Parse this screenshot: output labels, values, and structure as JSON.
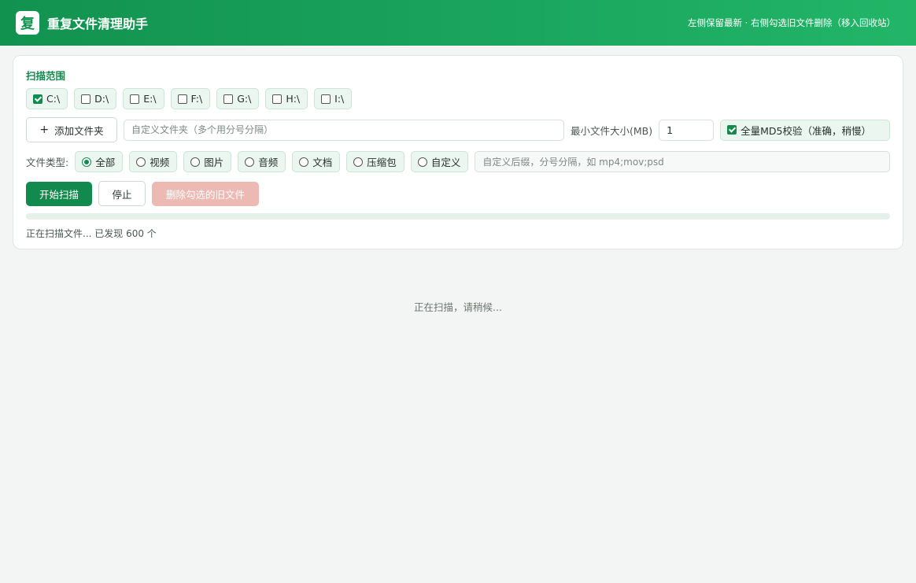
{
  "header": {
    "logo_char": "复",
    "title": "重复文件清理助手",
    "tip": "左侧保留最新 · 右侧勾选旧文件删除（移入回收站）",
    "accent": "#138a4d"
  },
  "scan": {
    "section_title": "扫描范围",
    "drives": [
      {
        "label": "C:\\",
        "checked": true
      },
      {
        "label": "D:\\",
        "checked": false
      },
      {
        "label": "E:\\",
        "checked": false
      },
      {
        "label": "F:\\",
        "checked": false
      },
      {
        "label": "G:\\",
        "checked": false
      },
      {
        "label": "H:\\",
        "checked": false
      },
      {
        "label": "I:\\",
        "checked": false
      }
    ],
    "add_folder_label": "添加文件夹",
    "add_folder_icon": "plus-icon",
    "folder_placeholder": "自定义文件夹（多个用分号分隔）",
    "min_size_label": "最小文件大小(MB)",
    "min_size_value": "1",
    "md5_label": "全量MD5校验（准确，稍慢）",
    "md5_checked": true
  },
  "file_types": {
    "label": "文件类型:",
    "options": [
      {
        "label": "全部",
        "checked": true
      },
      {
        "label": "视频",
        "checked": false
      },
      {
        "label": "图片",
        "checked": false
      },
      {
        "label": "音频",
        "checked": false
      },
      {
        "label": "文档",
        "checked": false
      },
      {
        "label": "压缩包",
        "checked": false
      },
      {
        "label": "自定义",
        "checked": false
      }
    ],
    "custom_ext_placeholder": "自定义后缀，分号分隔，如 mp4;mov;psd"
  },
  "actions": {
    "start_label": "开始扫描",
    "stop_label": "停止",
    "delete_label": "删除勾选的旧文件",
    "danger_color": "#ecb9b3"
  },
  "progress": {
    "fraction": 0,
    "status": "正在扫描文件... 已发现 600 个"
  },
  "results": {
    "message": "正在扫描，请稍候..."
  }
}
